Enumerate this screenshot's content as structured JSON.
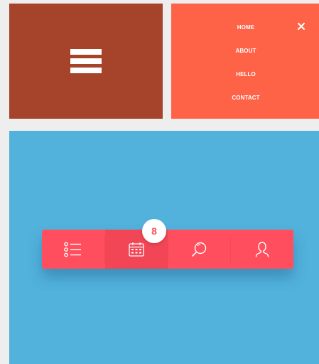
{
  "hamburger_panel": {
    "icon": "hamburger-menu-icon",
    "background": "#a5442a"
  },
  "menu_panel": {
    "background": "#ff6347",
    "items": [
      {
        "label": "HOME"
      },
      {
        "label": "ABOUT"
      },
      {
        "label": "HELLO"
      },
      {
        "label": "CONTACT"
      }
    ],
    "close_icon": "close-icon"
  },
  "tab_bar": {
    "background": "#ff4f5e",
    "page_background": "#52b2dc",
    "tabs": [
      {
        "icon": "list-icon"
      },
      {
        "icon": "calendar-icon"
      },
      {
        "icon": "search-icon"
      },
      {
        "icon": "user-icon"
      }
    ],
    "badge_count": "8"
  }
}
